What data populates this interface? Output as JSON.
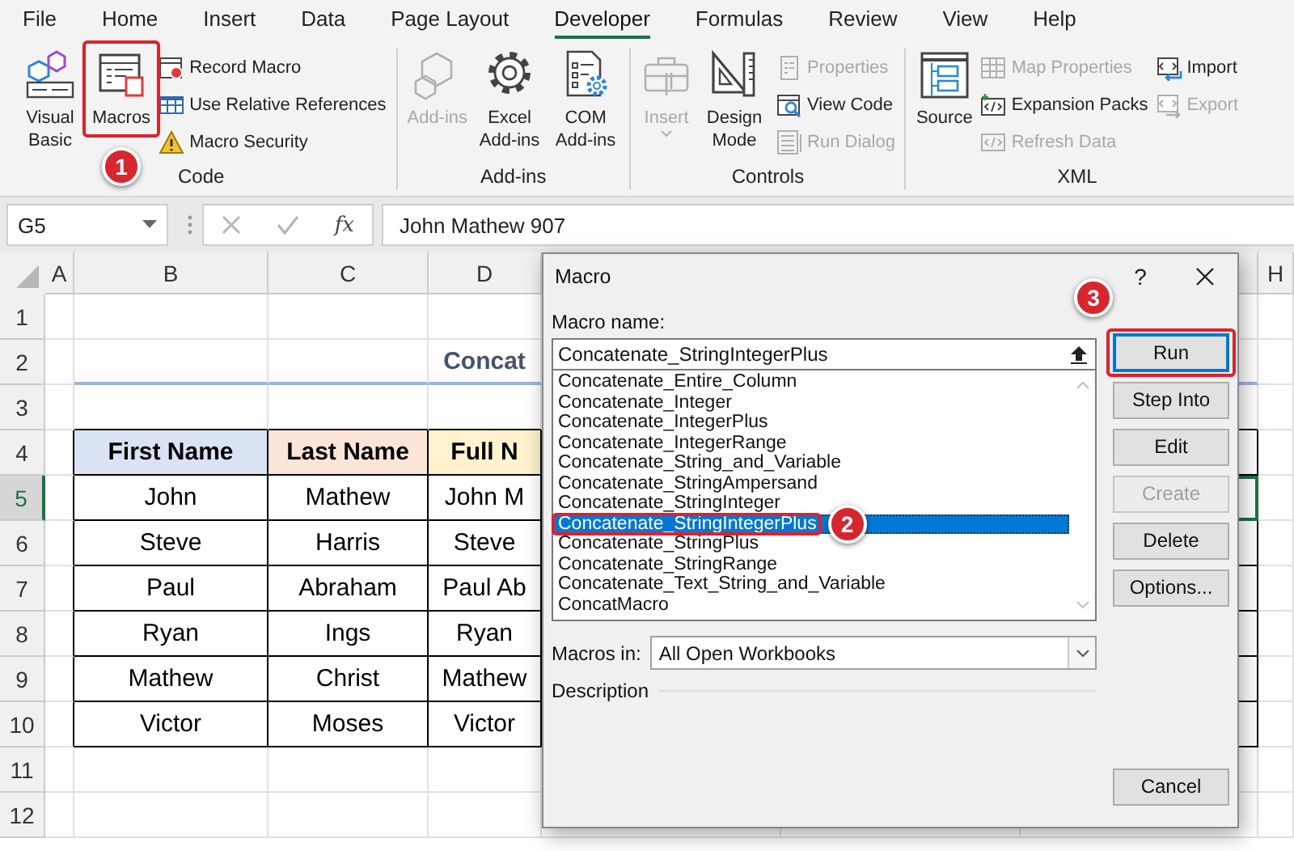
{
  "menu_tabs": [
    {
      "label": "File",
      "selected": false
    },
    {
      "label": "Home",
      "selected": false
    },
    {
      "label": "Insert",
      "selected": false
    },
    {
      "label": "Data",
      "selected": false
    },
    {
      "label": "Page Layout",
      "selected": false
    },
    {
      "label": "Developer",
      "selected": true
    },
    {
      "label": "Formulas",
      "selected": false
    },
    {
      "label": "Review",
      "selected": false
    },
    {
      "label": "View",
      "selected": false
    },
    {
      "label": "Help",
      "selected": false
    }
  ],
  "ribbon": {
    "groups": [
      {
        "label": "Code",
        "items": [
          {
            "kind": "large",
            "label": "Visual Basic",
            "disabled": false
          },
          {
            "kind": "large",
            "label": "Macros",
            "disabled": false
          },
          {
            "kind": "small",
            "label": "Record Macro",
            "disabled": false
          },
          {
            "kind": "small",
            "label": "Use Relative References",
            "disabled": false
          },
          {
            "kind": "small",
            "label": "Macro Security",
            "disabled": false
          }
        ]
      },
      {
        "label": "Add-ins",
        "items": [
          {
            "kind": "large",
            "label": "Add-ins",
            "disabled": true
          },
          {
            "kind": "large",
            "label": "Excel Add-ins",
            "disabled": false
          },
          {
            "kind": "large",
            "label": "COM Add-ins",
            "disabled": false
          }
        ]
      },
      {
        "label": "Controls",
        "items": [
          {
            "kind": "split",
            "label": "Insert",
            "disabled": true
          },
          {
            "kind": "large",
            "label": "Design Mode",
            "disabled": false
          },
          {
            "kind": "small",
            "label": "Properties",
            "disabled": true
          },
          {
            "kind": "small",
            "label": "View Code",
            "disabled": false
          },
          {
            "kind": "small",
            "label": "Run Dialog",
            "disabled": true
          }
        ]
      },
      {
        "label": "XML",
        "items": [
          {
            "kind": "large",
            "label": "Source",
            "disabled": false
          },
          {
            "kind": "small",
            "label": "Map Properties",
            "disabled": true
          },
          {
            "kind": "small",
            "label": "Expansion Packs",
            "disabled": false
          },
          {
            "kind": "small",
            "label": "Refresh Data",
            "disabled": true
          },
          {
            "kind": "small",
            "label": "Import",
            "disabled": false
          },
          {
            "kind": "small",
            "label": "Export",
            "disabled": true
          }
        ]
      }
    ]
  },
  "formula_bar": {
    "name_box": "G5",
    "function_label": "fx",
    "formula": "John Mathew 907"
  },
  "sheet": {
    "column_headers": [
      "A",
      "B",
      "C",
      "D",
      "H"
    ],
    "row_headers": [
      {
        "label": "1",
        "selected": false
      },
      {
        "label": "2",
        "selected": false
      },
      {
        "label": "3",
        "selected": false
      },
      {
        "label": "4",
        "selected": false
      },
      {
        "label": "5",
        "selected": true
      },
      {
        "label": "6",
        "selected": false
      },
      {
        "label": "7",
        "selected": false
      },
      {
        "label": "8",
        "selected": false
      },
      {
        "label": "9",
        "selected": false
      },
      {
        "label": "10",
        "selected": false
      },
      {
        "label": "11",
        "selected": false
      },
      {
        "label": "12",
        "selected": false
      }
    ],
    "title": "Concat",
    "columns": [
      {
        "label": "First Name",
        "color": "#dae3f3"
      },
      {
        "label": "Last Name",
        "color": "#fbe5d6"
      },
      {
        "label": "Full N",
        "color": "#fff2cc"
      }
    ],
    "rows": [
      [
        "John",
        "Mathew",
        "John M"
      ],
      [
        "Steve",
        "Harris",
        "Steve"
      ],
      [
        "Paul",
        "Abraham",
        "Paul Ab"
      ],
      [
        "Ryan",
        "Ings",
        "Ryan"
      ],
      [
        "Mathew",
        "Christ",
        "Mathew"
      ],
      [
        "Victor",
        "Moses",
        "Victor"
      ]
    ]
  },
  "dialog": {
    "title": "Macro",
    "help": "?",
    "macro_name_label": "Macro name:",
    "macro_name_value": "Concatenate_StringIntegerPlus",
    "macros": [
      {
        "name": "Concatenate_Entire_Column",
        "selected": false
      },
      {
        "name": "Concatenate_Integer",
        "selected": false
      },
      {
        "name": "Concatenate_IntegerPlus",
        "selected": false
      },
      {
        "name": "Concatenate_IntegerRange",
        "selected": false
      },
      {
        "name": "Concatenate_String_and_Variable",
        "selected": false
      },
      {
        "name": "Concatenate_StringAmpersand",
        "selected": false
      },
      {
        "name": "Concatenate_StringInteger",
        "selected": false
      },
      {
        "name": "Concatenate_StringIntegerPlus",
        "selected": true
      },
      {
        "name": "Concatenate_StringPlus",
        "selected": false
      },
      {
        "name": "Concatenate_StringRange",
        "selected": false
      },
      {
        "name": "Concatenate_Text_String_and_Variable",
        "selected": false
      },
      {
        "name": "ConcatMacro",
        "selected": false
      }
    ],
    "buttons": [
      {
        "kind": "action",
        "label": "Run",
        "default": true,
        "disabled": false
      },
      {
        "kind": "action",
        "label": "Step Into",
        "default": false,
        "disabled": false
      },
      {
        "kind": "action",
        "label": "Edit",
        "default": false,
        "disabled": false
      },
      {
        "kind": "action",
        "label": "Create",
        "default": false,
        "disabled": true
      },
      {
        "kind": "action",
        "label": "Delete",
        "default": false,
        "disabled": false
      },
      {
        "kind": "action",
        "label": "Options...",
        "default": false,
        "disabled": false
      },
      {
        "kind": "cancel",
        "label": "Cancel",
        "default": false,
        "disabled": false
      }
    ],
    "macros_in_label": "Macros in:",
    "macros_in_value": "All Open Workbooks",
    "description_label": "Description"
  },
  "callouts": [
    {
      "label": "1"
    },
    {
      "label": "2"
    },
    {
      "label": "3"
    }
  ]
}
